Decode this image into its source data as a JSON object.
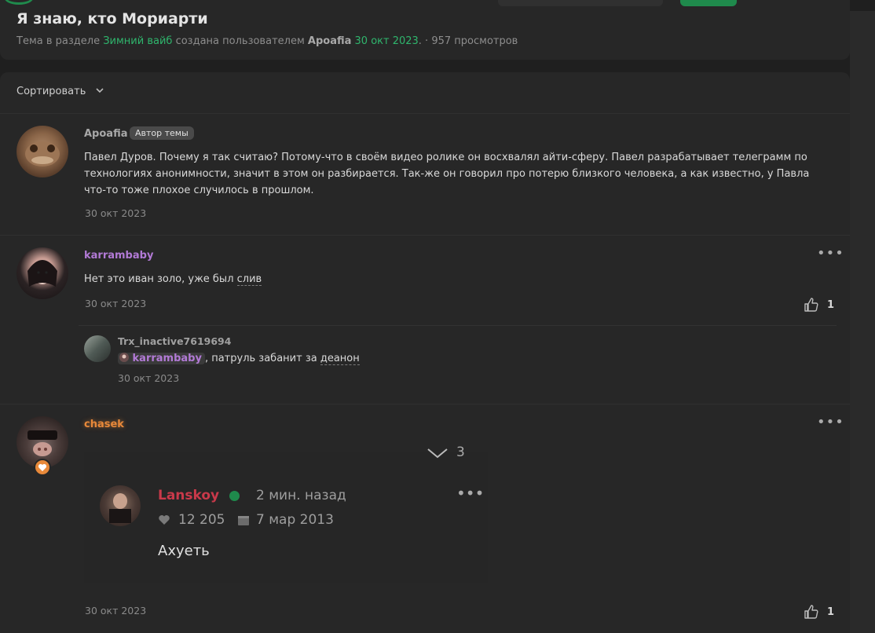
{
  "thread": {
    "title": "Я знаю, кто Мориарти",
    "meta_prefix": "Тема в разделе",
    "section": "Зимний вайб",
    "created_by": "создана пользователем",
    "author": "Apoafia",
    "date": "30 окт 2023",
    "dot": ". ·",
    "views": "957 просмотров"
  },
  "sort_label": "Сортировать",
  "posts": [
    {
      "user": "Apoafia",
      "badge": "Автор темы",
      "text": "Павел Дуров. Почему я так считаю? Потому-что в своём видео ролике он восхвалял айти-сферу. Павел разрабатывает телеграмм по технологиях анонимности, значит в этом он разбирается. Так-же он говорил про потерю близкого человека, а как известно, у Павла что-то тоже плохое случилось в прошлом.",
      "date": "30 окт 2023"
    },
    {
      "user": "karrambaby",
      "text_prefix": "Нет это иван золо, уже был ",
      "text_link": "слив",
      "date": "30 окт 2023",
      "likes": "1",
      "menu": "•••",
      "reply": {
        "user": "Trx_inactive7619694",
        "mention": "karrambaby",
        "text_prefix": ", патруль забанит за ",
        "text_link": "деанон",
        "date": "30 окт 2023"
      }
    },
    {
      "user": "chasek",
      "menu": "•••",
      "date": "30 окт 2023",
      "likes": "1",
      "embed": {
        "top_glyph": "3",
        "user": "Lanskoy",
        "time": "2 мин. назад",
        "likes": "12 205",
        "date": "7 мар 2013",
        "text": "Ахуеть",
        "menu": "•••"
      }
    }
  ],
  "colors": {
    "accent_green": "#2fb66d",
    "purple_user": "#b27ad6",
    "orange_user": "#e8893a",
    "embed_user": "#c9394a"
  }
}
